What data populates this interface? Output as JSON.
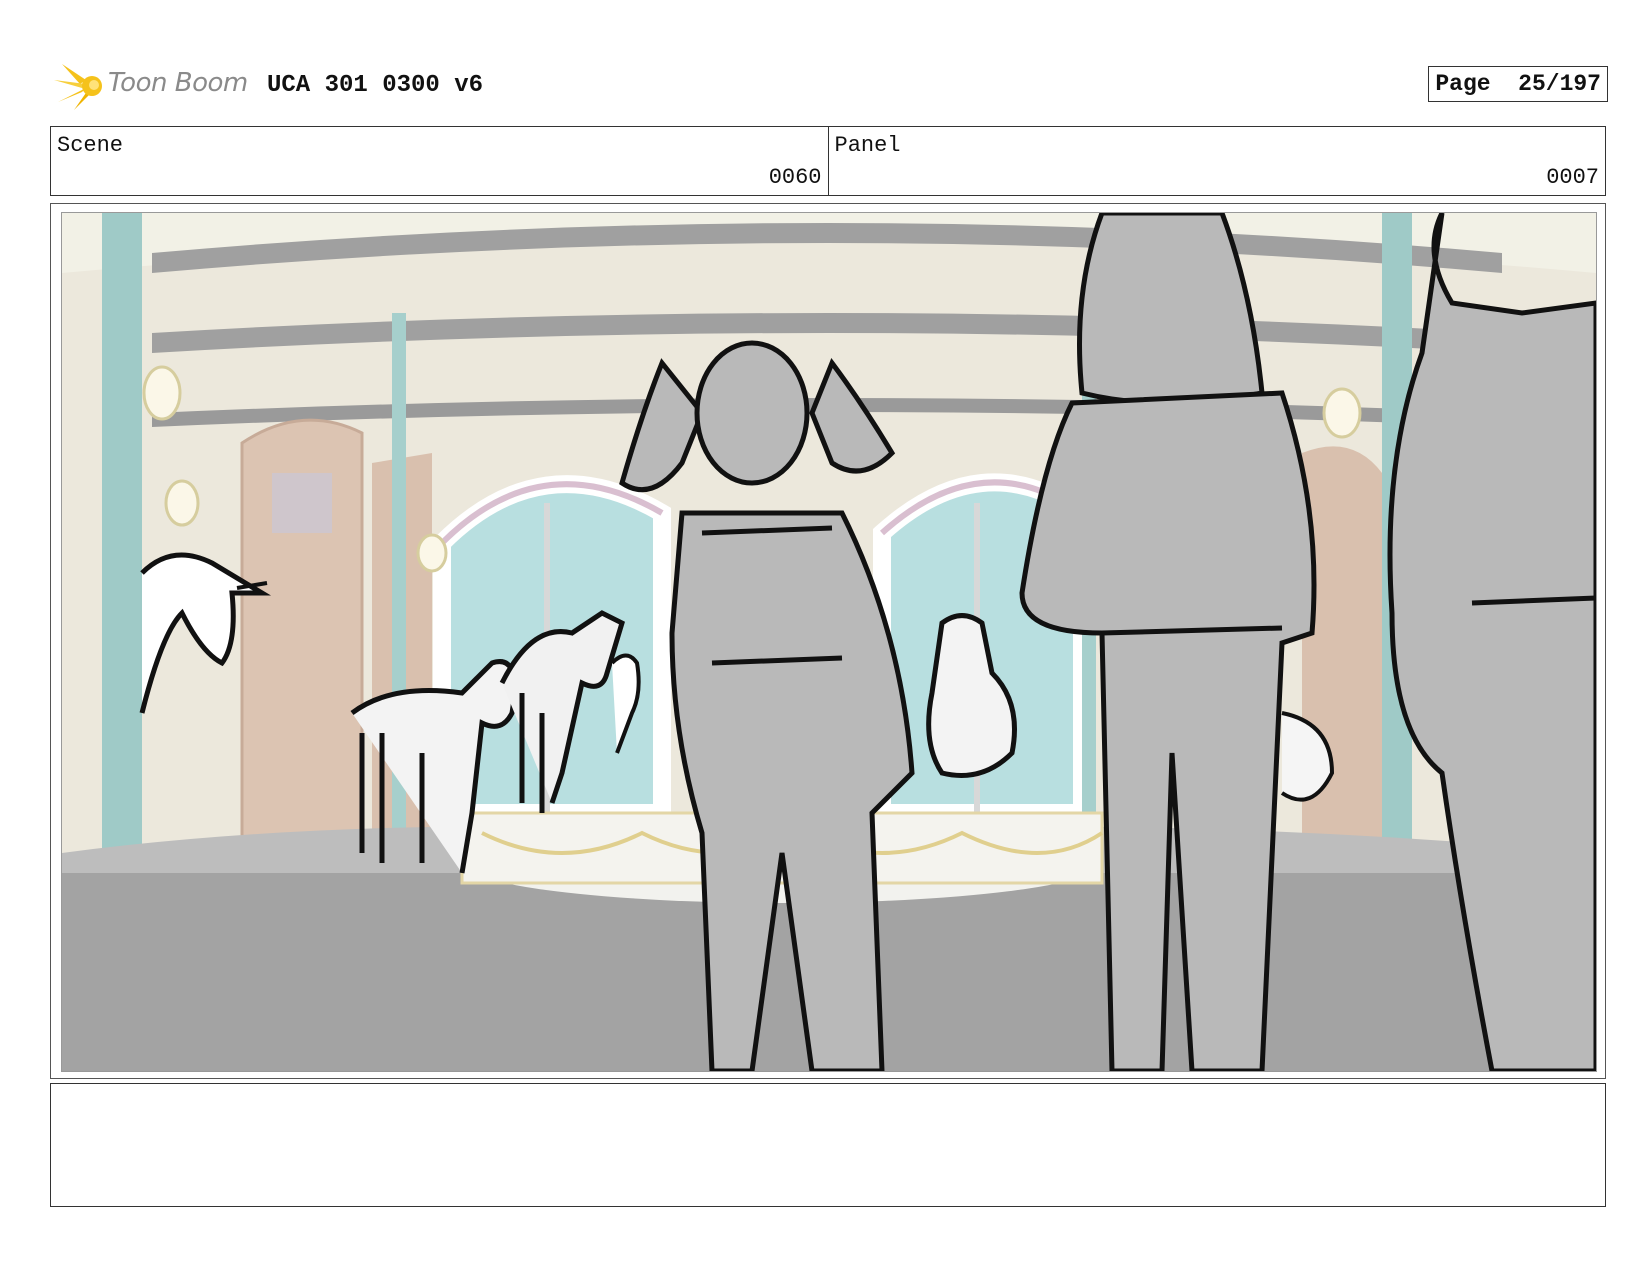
{
  "header": {
    "logo_text": "Toon Boom",
    "doc_title": "UCA 301 0300 v6",
    "page_label": "Page",
    "page_number": "25/197"
  },
  "info": {
    "scene_label": "Scene",
    "scene_value": "0060",
    "panel_label": "Panel",
    "panel_value": "0007"
  },
  "notes": {
    "text": ""
  },
  "colors": {
    "logo_accent": "#f5c21b",
    "sketch_fill": "#b9b9b9",
    "pillar": "#9fcac7",
    "window": "#b8dfe0",
    "wall": "#ece8dc",
    "floor": "#a3a3a3"
  }
}
